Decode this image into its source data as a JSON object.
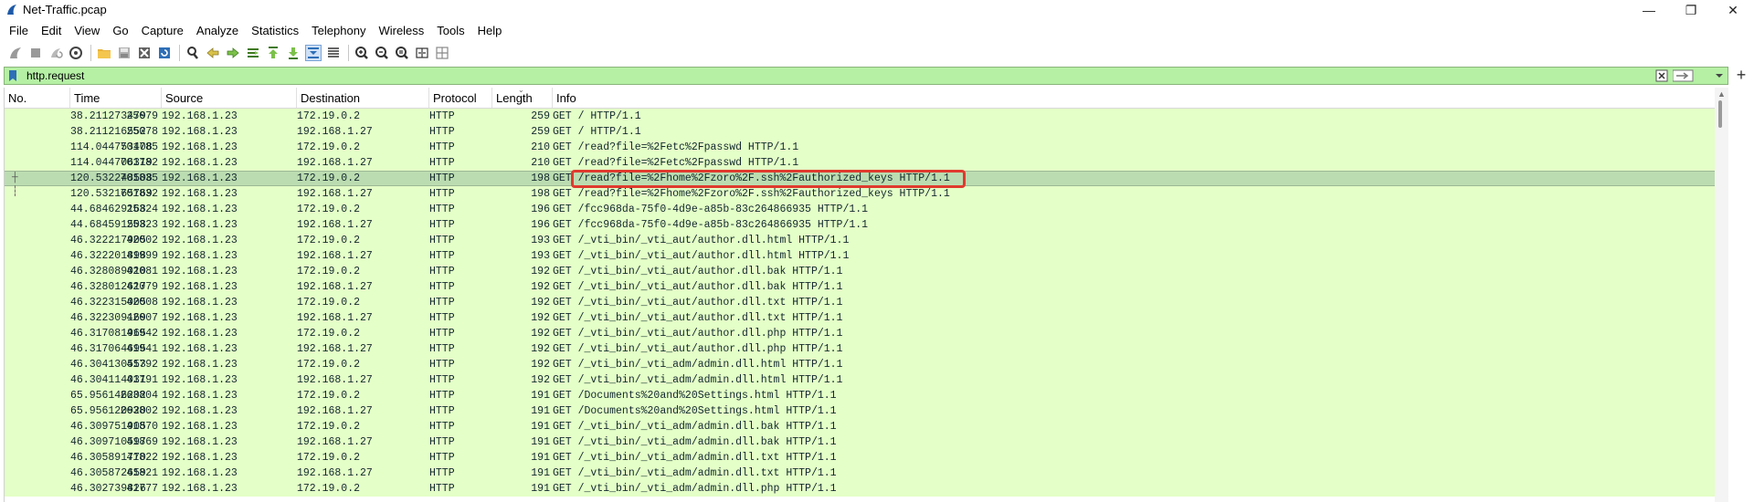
{
  "window": {
    "title": "Net-Traffic.pcap",
    "minimize_glyph": "—",
    "maximize_glyph": "❐",
    "close_glyph": "✕"
  },
  "menu": [
    "File",
    "Edit",
    "View",
    "Go",
    "Capture",
    "Analyze",
    "Statistics",
    "Telephony",
    "Wireless",
    "Tools",
    "Help"
  ],
  "filter": {
    "value": "http.request",
    "add_glyph": "+"
  },
  "columns": [
    "No.",
    "Time",
    "Source",
    "Destination",
    "Protocol",
    "Length",
    "Info"
  ],
  "rows": [
    {
      "no": "25079",
      "time": "38.211273479",
      "src": "192.168.1.23",
      "dst": "172.19.0.2",
      "proto": "HTTP",
      "len": "259",
      "info": "GET / HTTP/1.1"
    },
    {
      "no": "25078",
      "time": "38.211216552",
      "src": "192.168.1.23",
      "dst": "192.168.1.27",
      "proto": "HTTP",
      "len": "259",
      "info": "GET / HTTP/1.1"
    },
    {
      "no": "701785",
      "time": "114.044753408",
      "src": "192.168.1.23",
      "dst": "172.19.0.2",
      "proto": "HTTP",
      "len": "210",
      "info": "GET /read?file=%2Fetc%2Fpasswd HTTP/1.1"
    },
    {
      "no": "701782",
      "time": "114.044706319",
      "src": "192.168.1.23",
      "dst": "192.168.1.27",
      "proto": "HTTP",
      "len": "210",
      "info": "GET /read?file=%2Fetc%2Fpasswd HTTP/1.1"
    },
    {
      "no": "701835",
      "time": "120.532248508",
      "src": "192.168.1.23",
      "dst": "172.19.0.2",
      "proto": "HTTP",
      "len": "198",
      "info": "GET /read?file=%2Fhome%2Fzoro%2F.ssh%2Fauthorized_keys HTTP/1.1",
      "selected": true
    },
    {
      "no": "701832",
      "time": "120.532165769",
      "src": "192.168.1.23",
      "dst": "192.168.1.27",
      "proto": "HTTP",
      "len": "198",
      "info": "GET /read?file=%2Fhome%2Fzoro%2F.ssh%2Fauthorized_keys HTTP/1.1"
    },
    {
      "no": "25324",
      "time": "44.684629168",
      "src": "192.168.1.23",
      "dst": "172.19.0.2",
      "proto": "HTTP",
      "len": "196",
      "info": "GET /fcc968da-75f0-4d9e-a85b-83c264866935 HTTP/1.1"
    },
    {
      "no": "25323",
      "time": "44.684591508",
      "src": "192.168.1.23",
      "dst": "192.168.1.27",
      "proto": "HTTP",
      "len": "196",
      "info": "GET /fcc968da-75f0-4d9e-a85b-83c264866935 HTTP/1.1"
    },
    {
      "no": "42002",
      "time": "46.322217905",
      "src": "192.168.1.23",
      "dst": "172.19.0.2",
      "proto": "HTTP",
      "len": "193",
      "info": "GET /_vti_bin/_vti_aut/author.dll.html HTTP/1.1"
    },
    {
      "no": "41999",
      "time": "46.322201898",
      "src": "192.168.1.23",
      "dst": "192.168.1.27",
      "proto": "HTTP",
      "len": "193",
      "info": "GET /_vti_bin/_vti_aut/author.dll.html HTTP/1.1"
    },
    {
      "no": "42081",
      "time": "46.328089010",
      "src": "192.168.1.23",
      "dst": "172.19.0.2",
      "proto": "HTTP",
      "len": "192",
      "info": "GET /_vti_bin/_vti_aut/author.dll.bak HTTP/1.1"
    },
    {
      "no": "42079",
      "time": "46.328012617",
      "src": "192.168.1.23",
      "dst": "192.168.1.27",
      "proto": "HTTP",
      "len": "192",
      "info": "GET /_vti_bin/_vti_aut/author.dll.bak HTTP/1.1"
    },
    {
      "no": "42008",
      "time": "46.322315005",
      "src": "192.168.1.23",
      "dst": "172.19.0.2",
      "proto": "HTTP",
      "len": "192",
      "info": "GET /_vti_bin/_vti_aut/author.dll.txt HTTP/1.1"
    },
    {
      "no": "42007",
      "time": "46.322309169",
      "src": "192.168.1.23",
      "dst": "192.168.1.27",
      "proto": "HTTP",
      "len": "192",
      "info": "GET /_vti_bin/_vti_aut/author.dll.txt HTTP/1.1"
    },
    {
      "no": "41942",
      "time": "46.317081965",
      "src": "192.168.1.23",
      "dst": "172.19.0.2",
      "proto": "HTTP",
      "len": "192",
      "info": "GET /_vti_bin/_vti_aut/author.dll.php HTTP/1.1"
    },
    {
      "no": "41941",
      "time": "46.317064695",
      "src": "192.168.1.23",
      "dst": "192.168.1.27",
      "proto": "HTTP",
      "len": "192",
      "info": "GET /_vti_bin/_vti_aut/author.dll.php HTTP/1.1"
    },
    {
      "no": "41792",
      "time": "46.304130553",
      "src": "192.168.1.23",
      "dst": "172.19.0.2",
      "proto": "HTTP",
      "len": "192",
      "info": "GET /_vti_bin/_vti_adm/admin.dll.html HTTP/1.1"
    },
    {
      "no": "41791",
      "time": "46.304114031",
      "src": "192.168.1.23",
      "dst": "192.168.1.27",
      "proto": "HTTP",
      "len": "192",
      "info": "GET /_vti_bin/_vti_adm/admin.dll.html HTTP/1.1"
    },
    {
      "no": "263804",
      "time": "65.956146202",
      "src": "192.168.1.23",
      "dst": "172.19.0.2",
      "proto": "HTTP",
      "len": "191",
      "info": "GET /Documents%20and%20Settings.html HTTP/1.1"
    },
    {
      "no": "263802",
      "time": "65.956120920",
      "src": "192.168.1.23",
      "dst": "192.168.1.27",
      "proto": "HTTP",
      "len": "191",
      "info": "GET /Documents%20and%20Settings.html HTTP/1.1"
    },
    {
      "no": "41870",
      "time": "46.309751905",
      "src": "192.168.1.23",
      "dst": "172.19.0.2",
      "proto": "HTTP",
      "len": "191",
      "info": "GET /_vti_bin/_vti_adm/admin.dll.bak HTTP/1.1"
    },
    {
      "no": "41869",
      "time": "46.309710597",
      "src": "192.168.1.23",
      "dst": "192.168.1.27",
      "proto": "HTTP",
      "len": "191",
      "info": "GET /_vti_bin/_vti_adm/admin.dll.bak HTTP/1.1"
    },
    {
      "no": "41822",
      "time": "46.305891770",
      "src": "192.168.1.23",
      "dst": "172.19.0.2",
      "proto": "HTTP",
      "len": "191",
      "info": "GET /_vti_bin/_vti_adm/admin.dll.txt HTTP/1.1"
    },
    {
      "no": "41821",
      "time": "46.305872659",
      "src": "192.168.1.23",
      "dst": "192.168.1.27",
      "proto": "HTTP",
      "len": "191",
      "info": "GET /_vti_bin/_vti_adm/admin.dll.txt HTTP/1.1"
    },
    {
      "no": "41777",
      "time": "46.302739826",
      "src": "192.168.1.23",
      "dst": "172.19.0.2",
      "proto": "HTTP",
      "len": "191",
      "info": "GET /_vti_bin/_vti_adm/admin.dll.php HTTP/1.1"
    }
  ],
  "colors": {
    "filter_valid_bg": "#b5f0a5",
    "row_http_bg": "#e4ffc7",
    "row_selected_bg": "#bbdcb0",
    "annotation_box": "#e03a2e"
  },
  "icons": [
    "shark-fin-start-icon",
    "stop-icon",
    "restart-icon",
    "capture-options-icon",
    "open-file-icon",
    "save-file-icon",
    "close-file-icon",
    "reload-file-icon",
    "find-packet-icon",
    "go-back-icon",
    "go-forward-icon",
    "go-to-packet-icon",
    "first-packet-icon",
    "last-packet-icon",
    "autoscroll-icon",
    "colorize-icon",
    "zoom-in-icon",
    "zoom-out-icon",
    "normal-size-icon",
    "resize-columns-icon",
    "bookmark-icon",
    "clear-filter-icon",
    "apply-filter-icon"
  ]
}
